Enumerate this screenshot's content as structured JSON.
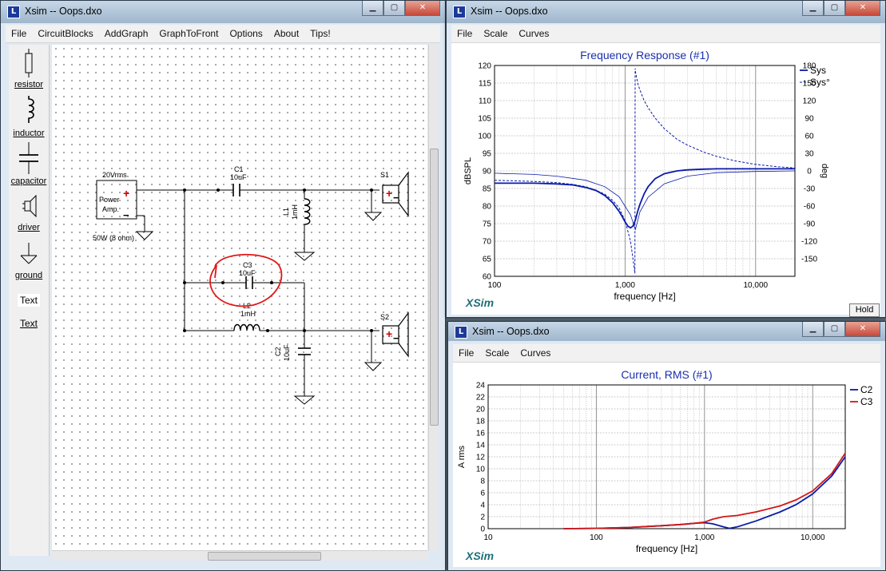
{
  "left_window": {
    "title": "Xsim -- Oops.dxo",
    "menu": [
      "File",
      "CircuitBlocks",
      "AddGraph",
      "GraphToFront",
      "Options",
      "About",
      "Tips!"
    ],
    "palette": [
      {
        "label": "resistor",
        "icon": "resistor-icon"
      },
      {
        "label": "inductor",
        "icon": "inductor-icon"
      },
      {
        "label": "capacitor",
        "icon": "capacitor-icon"
      },
      {
        "label": "driver",
        "icon": "driver-icon"
      },
      {
        "label": "ground",
        "icon": "ground-icon"
      },
      {
        "label": "Text",
        "icon": "text-icon"
      },
      {
        "label": "Text",
        "icon": "text-icon"
      }
    ],
    "circuit": {
      "amp_title": "20Vrms",
      "amp_label_1": "Power",
      "amp_label_2": "Amp.",
      "amp_sub": "50W (8 ohm)",
      "plus": "+",
      "minus": "−",
      "c1_name": "C1",
      "c1_value": "10uF",
      "l1_name": "L1",
      "l1_value": "1mH",
      "c3_name": "C3",
      "c3_value": "10uF",
      "l2_name": "L2",
      "l2_value": "1mH",
      "c2_name": "C2",
      "c2_value": "10uF",
      "s1_name": "S1",
      "s2_name": "S2",
      "annotation_color": "#e01818"
    }
  },
  "freq_window": {
    "title": "Xsim -- Oops.dxo",
    "menu": [
      "File",
      "Scale",
      "Curves"
    ],
    "logo": "XSim",
    "hold_label": "Hold"
  },
  "current_window": {
    "title": "Xsim -- Oops.dxo",
    "menu": [
      "File",
      "Scale",
      "Curves"
    ],
    "logo": "XSim"
  },
  "chart_data": [
    {
      "type": "line",
      "title": "Frequency Response (#1)",
      "xlabel": "frequency [Hz]",
      "ylabel": "dBSPL",
      "y2label": "deg",
      "x_scale": "log",
      "xlim": [
        100,
        20000
      ],
      "ylim": [
        60,
        120
      ],
      "y2lim": [
        -180,
        180
      ],
      "x_tick_labels": [
        "100",
        "1,000",
        "10,000"
      ],
      "y_ticks": [
        60,
        65,
        70,
        75,
        80,
        85,
        90,
        95,
        100,
        105,
        110,
        115,
        120
      ],
      "y2_ticks": [
        -150,
        -120,
        -90,
        -60,
        -30,
        0,
        30,
        60,
        90,
        120,
        150,
        180
      ],
      "grid": true,
      "legend_position": "top-right",
      "series": [
        {
          "name": "Sys",
          "axis": "left",
          "style": "solid",
          "color": "#0a1aa8",
          "x": [
            100,
            200,
            300,
            400,
            500,
            600,
            700,
            800,
            900,
            950,
            1000,
            1050,
            1100,
            1150,
            1200,
            1250,
            1300,
            1400,
            1500,
            1700,
            2000,
            2500,
            3000,
            4000,
            5000,
            7000,
            10000,
            15000,
            20000
          ],
          "y": [
            86.5,
            86.5,
            86.3,
            86.0,
            85.3,
            84.4,
            83.0,
            81.0,
            78.5,
            77.0,
            75.5,
            74.3,
            73.8,
            74.3,
            76.0,
            78.5,
            80.5,
            83.5,
            85.5,
            87.8,
            89.2,
            90.0,
            90.3,
            90.5,
            90.6,
            90.6,
            90.6,
            90.6,
            90.6
          ]
        },
        {
          "name": "Sys°",
          "axis": "right",
          "style": "dashed",
          "color": "#0a1aa8",
          "x": [
            100,
            200,
            300,
            400,
            500,
            600,
            700,
            800,
            900,
            1000,
            1100,
            1150,
            1190,
            1195,
            1200,
            1250,
            1300,
            1400,
            1500,
            1700,
            2000,
            2500,
            3000,
            4000,
            5000,
            7000,
            10000,
            15000,
            20000
          ],
          "y": [
            -16,
            -18,
            -20,
            -23,
            -27,
            -33,
            -40,
            -50,
            -63,
            -85,
            -120,
            -150,
            -175,
            175,
            170,
            150,
            138,
            120,
            108,
            90,
            72,
            54,
            44,
            32,
            25,
            17,
            11,
            7,
            5
          ]
        },
        {
          "name": "",
          "axis": "right",
          "style": "thin",
          "color": "#0a1aa8",
          "x": [
            100,
            200,
            300,
            500,
            700,
            900,
            1100,
            1200,
            1250,
            1300,
            1500,
            2000,
            3000,
            5000,
            10000,
            20000
          ],
          "y": [
            -4,
            -6,
            -9,
            -16,
            -27,
            -44,
            -75,
            -100,
            -85,
            -70,
            -45,
            -22,
            -9,
            -3,
            -1,
            0
          ]
        }
      ]
    },
    {
      "type": "line",
      "title": "Current, RMS (#1)",
      "xlabel": "frequency [Hz]",
      "ylabel": "A rms",
      "x_scale": "log",
      "xlim": [
        10,
        20000
      ],
      "ylim": [
        0,
        24
      ],
      "x_tick_labels": [
        "10",
        "100",
        "1,000",
        "10,000"
      ],
      "y_ticks": [
        0,
        2,
        4,
        6,
        8,
        10,
        12,
        14,
        16,
        18,
        20,
        22,
        24
      ],
      "grid": true,
      "legend_position": "top-right",
      "series": [
        {
          "name": "C2",
          "color": "#0a1aa8",
          "x": [
            50,
            100,
            200,
            400,
            600,
            800,
            1000,
            1200,
            1500,
            1700,
            2000,
            3000,
            5000,
            7000,
            10000,
            15000,
            20000
          ],
          "y": [
            0.0,
            0.05,
            0.2,
            0.5,
            0.7,
            0.9,
            1.0,
            0.8,
            0.3,
            0.05,
            0.3,
            1.3,
            2.8,
            4.0,
            5.8,
            8.8,
            12.0
          ]
        },
        {
          "name": "C3",
          "color": "#d01818",
          "x": [
            50,
            100,
            200,
            400,
            600,
            800,
            1000,
            1200,
            1500,
            2000,
            3000,
            5000,
            7000,
            10000,
            15000,
            20000
          ],
          "y": [
            0.0,
            0.05,
            0.2,
            0.5,
            0.7,
            0.9,
            1.1,
            1.6,
            2.0,
            2.2,
            2.8,
            3.8,
            4.8,
            6.3,
            9.2,
            12.6
          ]
        }
      ]
    }
  ]
}
